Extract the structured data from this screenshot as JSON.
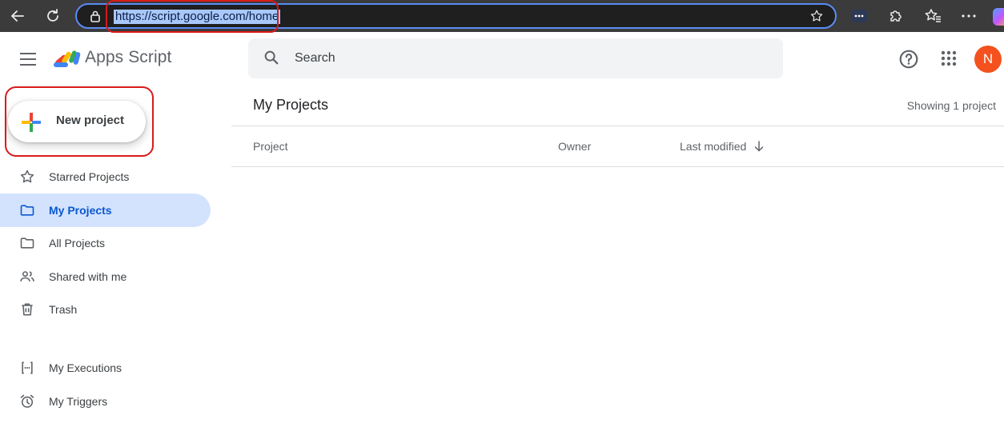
{
  "browser": {
    "url": "https://script.google.com/home"
  },
  "app": {
    "title": "Apps Script"
  },
  "search": {
    "placeholder": "Search"
  },
  "user": {
    "avatar_initial": "N",
    "avatar_color": "#f4511e"
  },
  "new_project": {
    "label": "New project"
  },
  "sidebar": {
    "items": [
      {
        "label": "Starred Projects",
        "icon": "star-icon"
      },
      {
        "label": "My Projects",
        "icon": "folder-icon",
        "active": true
      },
      {
        "label": "All Projects",
        "icon": "folder-icon"
      },
      {
        "label": "Shared with me",
        "icon": "people-icon"
      },
      {
        "label": "Trash",
        "icon": "trash-icon"
      },
      {
        "label": "My Executions",
        "icon": "executions-icon"
      },
      {
        "label": "My Triggers",
        "icon": "alarm-clock-icon"
      }
    ]
  },
  "main": {
    "title": "My Projects",
    "showing": "Showing 1 project",
    "columns": [
      "Project",
      "Owner",
      "Last modified"
    ]
  },
  "colors": {
    "accent": "#0b57d0",
    "active_bg": "#d3e3fd",
    "annotation_red": "#d81b1b"
  }
}
